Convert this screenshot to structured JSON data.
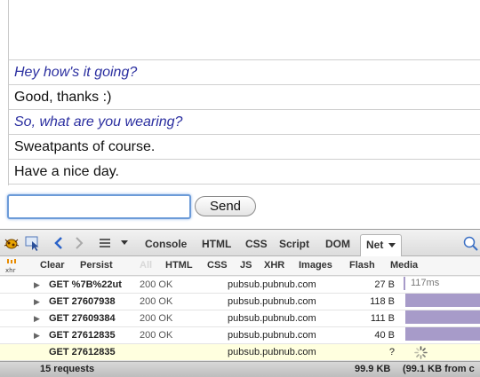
{
  "chat": {
    "messages": [
      {
        "text": "Hey how's it going?",
        "italic": true
      },
      {
        "text": "Good, thanks :)",
        "italic": false
      },
      {
        "text": "So, what are you wearing?",
        "italic": true
      },
      {
        "text": "Sweatpants of course.",
        "italic": false
      },
      {
        "text": "Have a nice day.",
        "italic": false
      }
    ],
    "input_value": "",
    "send_label": "Send"
  },
  "firebug": {
    "tabs": [
      "Console",
      "HTML",
      "CSS",
      "Script",
      "DOM"
    ],
    "active_tab": "Net",
    "icons": [
      "firebug-bug-icon",
      "inspect-icon",
      "back-icon",
      "forward-icon",
      "list-menu-icon",
      "dropdown-icon",
      "search-icon"
    ],
    "subbar": {
      "clear": "Clear",
      "persist": "Persist",
      "all": "All",
      "filters": [
        "HTML",
        "CSS",
        "JS",
        "XHR",
        "Images",
        "Flash",
        "Media"
      ],
      "xhr_icon_label": "xhr"
    },
    "requests": [
      {
        "url": "GET %7B%22ut",
        "status": "200 OK",
        "domain": "pubsub.pubnub.com",
        "size": "27 B",
        "timing": "117ms",
        "pending": false
      },
      {
        "url": "GET 27607938",
        "status": "200 OK",
        "domain": "pubsub.pubnub.com",
        "size": "118 B",
        "timing": "",
        "pending": false
      },
      {
        "url": "GET 27609384",
        "status": "200 OK",
        "domain": "pubsub.pubnub.com",
        "size": "111 B",
        "timing": "",
        "pending": false
      },
      {
        "url": "GET 27612835",
        "status": "200 OK",
        "domain": "pubsub.pubnub.com",
        "size": "40 B",
        "timing": "",
        "pending": false
      },
      {
        "url": "GET 27612835",
        "status": "",
        "domain": "pubsub.pubnub.com",
        "size": "?",
        "timing": "",
        "pending": true
      }
    ],
    "summary": {
      "count": "15 requests",
      "total": "99.9 KB",
      "cached": "(99.1 KB from c"
    },
    "colors": {
      "timeline_bar": "#a79bc9",
      "pending_row": "#ffffdf"
    }
  }
}
